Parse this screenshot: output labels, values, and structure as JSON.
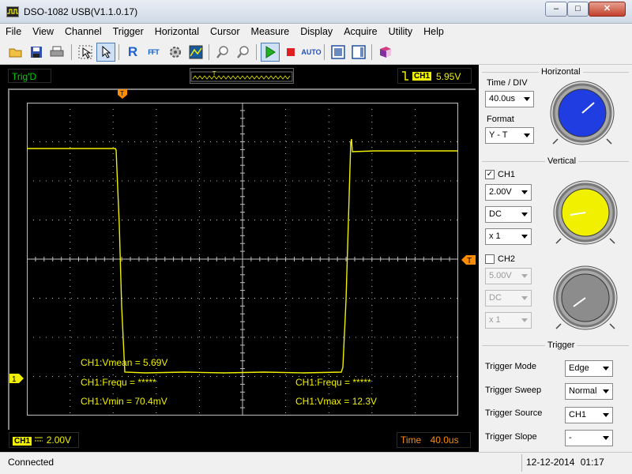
{
  "window": {
    "title": "DSO-1082 USB(V1.1.0.17)",
    "minimize": "–",
    "maximize": "□",
    "close": "✕"
  },
  "menu": [
    "File",
    "View",
    "Channel",
    "Trigger",
    "Horizontal",
    "Cursor",
    "Measure",
    "Display",
    "Acquire",
    "Utility",
    "Help"
  ],
  "toolbar": {
    "icons": [
      "open-icon",
      "save-icon",
      "print-icon",
      "select-cursor-icon",
      "pointer-icon",
      "r-icon",
      "fft-icon",
      "settings-icon",
      "image-icon",
      "zoom-in-icon",
      "zoom-out-icon",
      "run-icon",
      "stop-icon",
      "auto-icon",
      "fullscreen-icon",
      "panel-icon",
      "book-icon"
    ],
    "r_label": "R",
    "fft_label": "FFT",
    "auto_label": "AUTO"
  },
  "display": {
    "trig_status": "Trig'D",
    "trigger_marker": "T",
    "trigger_channel": "CH1",
    "trigger_level": "5.95V",
    "ch1_badge": "CH1",
    "ch1_scale": "2.00V",
    "time_label": "Time",
    "time_value": "40.0us",
    "ch1_marker": "1",
    "level_marker": "T",
    "measurements": {
      "vmean": "CH1:Vmean = 5.69V",
      "frequ_left": "CH1:Frequ = *****",
      "vmin": "CH1:Vmin = 70.4mV",
      "frequ_right": "CH1:Frequ = *****",
      "vmax": "CH1:Vmax = 12.3V"
    },
    "trace_color": "#f0f000",
    "grid_color": "#c0c0c0"
  },
  "panel": {
    "horizontal": {
      "title": "Horizontal",
      "time_div_label": "Time / DIV",
      "time_div_value": "40.0us",
      "format_label": "Format",
      "format_value": "Y - T",
      "knob_color": "#1f3de0"
    },
    "vertical": {
      "title": "Vertical",
      "ch1_label": "CH1",
      "ch1_checked": true,
      "ch1_volts": "2.00V",
      "ch1_coupling": "DC",
      "ch1_probe": "x 1",
      "ch1_knob_color": "#f0f000",
      "ch2_label": "CH2",
      "ch2_checked": false,
      "ch2_volts": "5.00V",
      "ch2_coupling": "DC",
      "ch2_probe": "x 1",
      "ch2_knob_color": "#8c8c8c"
    },
    "trigger": {
      "title": "Trigger",
      "mode_label": "Trigger Mode",
      "mode_value": "Edge",
      "sweep_label": "Trigger Sweep",
      "sweep_value": "Normal",
      "source_label": "Trigger Source",
      "source_value": "CH1",
      "slope_label": "Trigger Slope",
      "slope_value": "-"
    }
  },
  "statusbar": {
    "connection": "Connected",
    "date": "12-12-2014",
    "time": "01:17"
  }
}
